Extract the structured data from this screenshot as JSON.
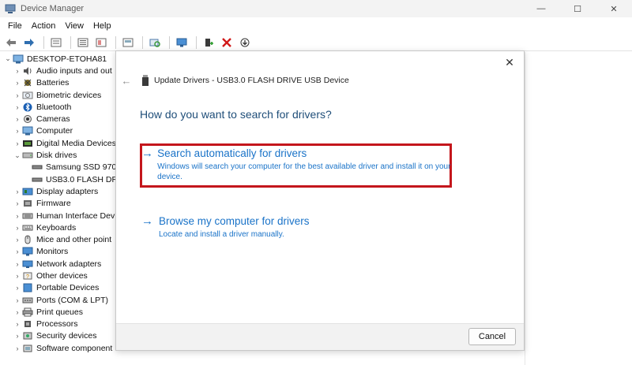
{
  "window": {
    "title": "Device Manager",
    "controls": {
      "minimize": "—",
      "maximize": "☐",
      "close": "✕"
    }
  },
  "menu": [
    "File",
    "Action",
    "View",
    "Help"
  ],
  "toolbar": {
    "icons": [
      "back-arrow-icon",
      "forward-arrow-icon",
      "properties-icon",
      "details-icon",
      "help-icon",
      "view-icon",
      "scan-icon",
      "monitor-icon",
      "add-driver-icon",
      "uninstall-icon",
      "download-icon"
    ]
  },
  "tree": {
    "root": "DESKTOP-ETOHA81",
    "items": [
      {
        "label": "Audio inputs and out",
        "icon": "audio-icon",
        "expanded": false,
        "depth": 1
      },
      {
        "label": "Batteries",
        "icon": "battery-icon",
        "expanded": false,
        "depth": 1
      },
      {
        "label": "Biometric devices",
        "icon": "biometric-icon",
        "expanded": false,
        "depth": 1
      },
      {
        "label": "Bluetooth",
        "icon": "bluetooth-icon",
        "expanded": false,
        "depth": 1
      },
      {
        "label": "Cameras",
        "icon": "camera-icon",
        "expanded": false,
        "depth": 1
      },
      {
        "label": "Computer",
        "icon": "computer-icon",
        "expanded": false,
        "depth": 1
      },
      {
        "label": "Digital Media Devices",
        "icon": "media-icon",
        "expanded": false,
        "depth": 1
      },
      {
        "label": "Disk drives",
        "icon": "disk-icon",
        "expanded": true,
        "depth": 1
      },
      {
        "label": "Samsung SSD 970",
        "icon": "drive-icon",
        "expanded": null,
        "depth": 2
      },
      {
        "label": "USB3.0 FLASH DR",
        "icon": "drive-icon",
        "expanded": null,
        "depth": 2
      },
      {
        "label": "Display adapters",
        "icon": "display-icon",
        "expanded": false,
        "depth": 1
      },
      {
        "label": "Firmware",
        "icon": "firmware-icon",
        "expanded": false,
        "depth": 1
      },
      {
        "label": "Human Interface Dev",
        "icon": "hid-icon",
        "expanded": false,
        "depth": 1
      },
      {
        "label": "Keyboards",
        "icon": "keyboard-icon",
        "expanded": false,
        "depth": 1
      },
      {
        "label": "Mice and other point",
        "icon": "mouse-icon",
        "expanded": false,
        "depth": 1
      },
      {
        "label": "Monitors",
        "icon": "monitor-icon",
        "expanded": false,
        "depth": 1
      },
      {
        "label": "Network adapters",
        "icon": "network-icon",
        "expanded": false,
        "depth": 1
      },
      {
        "label": "Other devices",
        "icon": "other-icon",
        "expanded": false,
        "depth": 1
      },
      {
        "label": "Portable Devices",
        "icon": "portable-icon",
        "expanded": false,
        "depth": 1
      },
      {
        "label": "Ports (COM & LPT)",
        "icon": "port-icon",
        "expanded": false,
        "depth": 1
      },
      {
        "label": "Print queues",
        "icon": "printer-icon",
        "expanded": false,
        "depth": 1
      },
      {
        "label": "Processors",
        "icon": "processor-icon",
        "expanded": false,
        "depth": 1
      },
      {
        "label": "Security devices",
        "icon": "security-icon",
        "expanded": false,
        "depth": 1
      },
      {
        "label": "Software component",
        "icon": "software-icon",
        "expanded": false,
        "depth": 1
      }
    ]
  },
  "dialog": {
    "header": "Update Drivers - USB3.0 FLASH DRIVE USB Device",
    "question": "How do you want to search for drivers?",
    "option_auto": {
      "arrow": "→",
      "title": "Search automatically for drivers",
      "description": "Windows will search your computer for the best available driver and install it on your device."
    },
    "option_browse": {
      "arrow": "→",
      "title": "Browse my computer for drivers",
      "description": "Locate and install a driver manually."
    },
    "cancel_label": "Cancel",
    "close_glyph": "✕",
    "back_glyph": "←"
  },
  "colors": {
    "link_blue": "#1a73c8",
    "heading_blue": "#1f4e79",
    "highlight_red": "#c4161c"
  }
}
